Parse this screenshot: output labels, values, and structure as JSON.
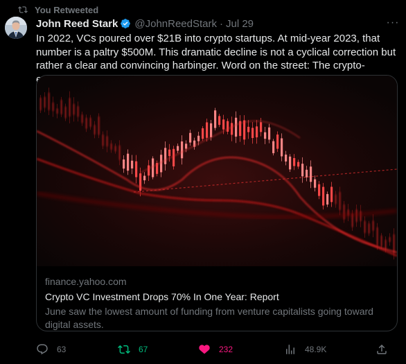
{
  "retweet_banner": {
    "label": "You Retweeted"
  },
  "tweet": {
    "author": {
      "name": "John Reed Stark",
      "handle": "@JohnReedStark"
    },
    "date": "Jul 29",
    "separator": "·",
    "text": "In 2022, VCs poured over $21B into crypto startups. At mid-year 2023, that number is a paltry $500M. This dramatic decline is not a cyclical correction but rather a clear and convincing harbinger. Word on the street: The crypto-emperor has no clothes.",
    "more_label": "···"
  },
  "card": {
    "domain": "finance.yahoo.com",
    "title": "Crypto VC Investment Drops 70% In One Year: Report",
    "description": "June saw the lowest amount of funding from venture capitalists going toward digital assets."
  },
  "actions": {
    "replies": "63",
    "retweets": "67",
    "likes": "232",
    "views": "48.9K"
  },
  "colors": {
    "background": "#000000",
    "text_primary": "#e7e9ea",
    "text_secondary": "#71767b",
    "verified": "#1d9bf0",
    "retweeted": "#00ba7c",
    "liked": "#f91880",
    "border": "#2f3336"
  },
  "icons": {
    "retweet_banner": "retweet-icon",
    "verified": "verified-badge-icon",
    "reply": "reply-icon",
    "retweet": "retweet-icon",
    "like": "heart-filled-icon",
    "views": "bar-chart-icon",
    "share": "share-icon"
  }
}
